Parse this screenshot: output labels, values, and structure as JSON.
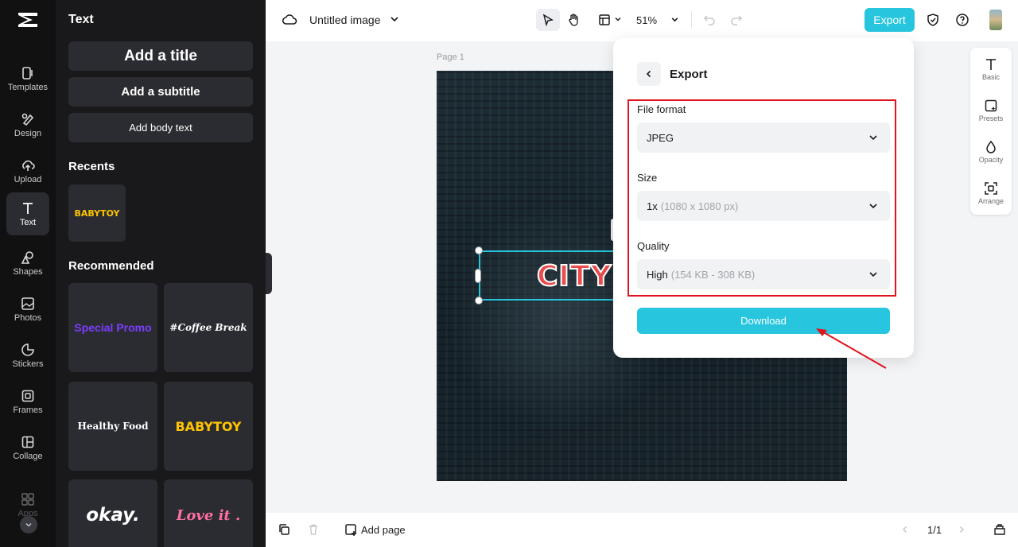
{
  "rail": {
    "items": [
      {
        "label": "Templates",
        "icon": "templates-icon"
      },
      {
        "label": "Design",
        "icon": "design-icon"
      },
      {
        "label": "Upload",
        "icon": "upload-icon"
      },
      {
        "label": "Text",
        "icon": "text-icon"
      },
      {
        "label": "Shapes",
        "icon": "shapes-icon"
      },
      {
        "label": "Photos",
        "icon": "photos-icon"
      },
      {
        "label": "Stickers",
        "icon": "stickers-icon"
      },
      {
        "label": "Frames",
        "icon": "frames-icon"
      },
      {
        "label": "Collage",
        "icon": "collage-icon"
      },
      {
        "label": "Apps",
        "icon": "apps-icon"
      }
    ],
    "active": "Text"
  },
  "panel": {
    "title": "Text",
    "add_title": "Add a title",
    "add_subtitle": "Add a subtitle",
    "add_body": "Add body text",
    "recents_heading": "Recents",
    "recents": [
      {
        "text": "BABYTOY"
      }
    ],
    "recommended_heading": "Recommended",
    "recommended": [
      {
        "text": "Special Promo"
      },
      {
        "text": "#Coffee Break"
      },
      {
        "text": "Healthy Food"
      },
      {
        "text": "BABYTOY"
      },
      {
        "text": "okay."
      },
      {
        "text": "Love it ."
      }
    ]
  },
  "topbar": {
    "doc_title": "Untitled image",
    "zoom": "51%",
    "export_label": "Export"
  },
  "canvas": {
    "page_label": "Page 1",
    "headline": "CITY"
  },
  "mini_tools": [
    {
      "label": "Basic",
      "icon": "text-basic-icon"
    },
    {
      "label": "Presets",
      "icon": "presets-icon"
    },
    {
      "label": "Opacity",
      "icon": "opacity-icon"
    },
    {
      "label": "Arrange",
      "icon": "arrange-icon"
    }
  ],
  "export_panel": {
    "title": "Export",
    "file_format_label": "File format",
    "file_format_value": "JPEG",
    "size_label": "Size",
    "size_value": "1x",
    "size_detail": "(1080 x 1080 px)",
    "quality_label": "Quality",
    "quality_value": "High",
    "quality_detail": "(154 KB - 308 KB)",
    "download_label": "Download"
  },
  "bottombar": {
    "add_page_label": "Add page",
    "page_indicator": "1/1"
  },
  "colors": {
    "accent": "#27c5de",
    "highlight_red": "#e0141e",
    "rail_bg": "#111112",
    "panel_bg": "#19191b"
  }
}
